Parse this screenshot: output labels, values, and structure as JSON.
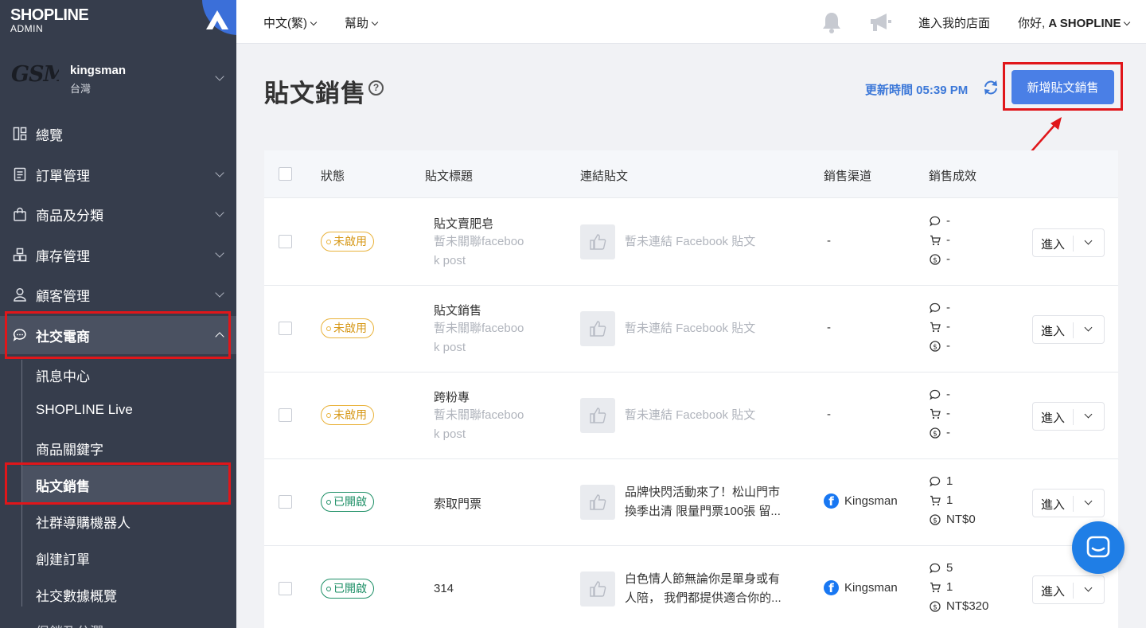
{
  "sidebar": {
    "logo_main": "SHOPLINE",
    "logo_sub": "ADMIN",
    "store_mark": "GSM",
    "store_name": "kingsman",
    "store_region": "台灣",
    "nav": [
      {
        "label": "總覽",
        "icon": "dashboard-icon"
      },
      {
        "label": "訂單管理",
        "icon": "order-icon"
      },
      {
        "label": "商品及分類",
        "icon": "bag-icon"
      },
      {
        "label": "庫存管理",
        "icon": "inventory-icon"
      },
      {
        "label": "顧客管理",
        "icon": "user-icon"
      },
      {
        "label": "社交電商",
        "icon": "chat-icon"
      }
    ],
    "sub_nav": [
      "訊息中心",
      "SHOPLINE Live",
      "商品關鍵字",
      "貼文銷售",
      "社群導購機器人",
      "創建訂單",
      "社交數據概覽"
    ],
    "next_nav": "促銷及分潤"
  },
  "topbar": {
    "language": "中文(繁)",
    "help": "幫助",
    "enter_store": "進入我的店面",
    "greeting": "你好, ",
    "user": "A SHOPLINE"
  },
  "page": {
    "title": "貼文銷售",
    "help_glyph": "?",
    "update_time": "更新時間 05:39 PM",
    "new_button": "新增貼文銷售"
  },
  "table": {
    "headers": [
      "狀態",
      "貼文標題",
      "連結貼文",
      "銷售渠道",
      "銷售成效"
    ],
    "enter_label": "進入",
    "rows": [
      {
        "status": "未啟用",
        "status_type": "off",
        "title": "貼文賣肥皂",
        "subtitle": "暫未關聯facebook post",
        "post_line1": "暫未連結 Facebook 貼文",
        "post_line2": "",
        "channel": "-",
        "comments": "-",
        "orders": "-",
        "revenue": "-"
      },
      {
        "status": "未啟用",
        "status_type": "off",
        "title": "貼文銷售",
        "subtitle": "暫未關聯facebook post",
        "post_line1": "暫未連結 Facebook 貼文",
        "post_line2": "",
        "channel": "-",
        "comments": "-",
        "orders": "-",
        "revenue": "-"
      },
      {
        "status": "未啟用",
        "status_type": "off",
        "title": "跨粉專",
        "subtitle": "暫未關聯facebook post",
        "post_line1": "暫未連結 Facebook 貼文",
        "post_line2": "",
        "channel": "-",
        "comments": "-",
        "orders": "-",
        "revenue": "-"
      },
      {
        "status": "已開啟",
        "status_type": "on",
        "title": "索取門票",
        "subtitle": "",
        "post_line1": "品牌快閃活動來了！松山門市",
        "post_line2": "換季出清 限量門票100張 留...",
        "channel": "Kingsman",
        "comments": "1",
        "orders": "1",
        "revenue": "NT$0"
      },
      {
        "status": "已開啟",
        "status_type": "on",
        "title": "314",
        "subtitle": "",
        "post_line1": "白色情人節無論你是單身或有",
        "post_line2": "人陪， 我們都提供適合你的...",
        "channel": "Kingsman",
        "comments": "5",
        "orders": "1",
        "revenue": "NT$320"
      }
    ]
  }
}
